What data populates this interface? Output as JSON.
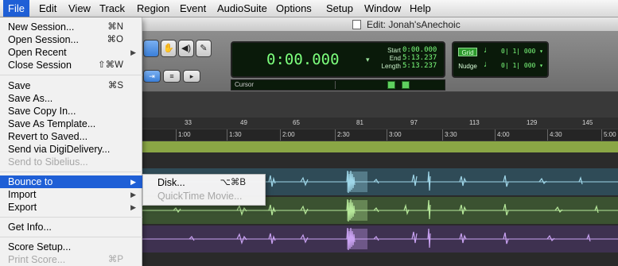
{
  "menubar": {
    "items": [
      "File",
      "Edit",
      "View",
      "Track",
      "Region",
      "Event",
      "AudioSuite",
      "Options",
      "Setup",
      "Window",
      "Help"
    ]
  },
  "window": {
    "title": "Edit: Jonah'sAnechoic"
  },
  "toolbar": {
    "main_counter": "0:00.000",
    "start_label": "Start",
    "start_value": "0:00.000",
    "end_label": "End",
    "end_value": "5:13.237",
    "length_label": "Length",
    "length_value": "5:13.237",
    "cursor_label": "Cursor",
    "grid_label": "Grid",
    "grid_value": "0| 1| 000",
    "nudge_label": "Nudge",
    "nudge_value": "0| 1| 000"
  },
  "ruler": {
    "bars": [
      "33",
      "49",
      "65",
      "81",
      "97",
      "113",
      "129",
      "145"
    ],
    "minsecs": [
      "1:00",
      "1:30",
      "2:00",
      "2:30",
      "3:00",
      "3:30",
      "4:00",
      "4:30",
      "5:00"
    ]
  },
  "file_menu": {
    "items": [
      {
        "label": "New Session...",
        "shortcut": "⌘N"
      },
      {
        "label": "Open Session...",
        "shortcut": "⌘O"
      },
      {
        "label": "Open Recent",
        "submenu": "▶"
      },
      {
        "label": "Close Session",
        "shortcut": "⇧⌘W"
      },
      {
        "label": "Save",
        "shortcut": "⌘S"
      },
      {
        "label": "Save As..."
      },
      {
        "label": "Save Copy In..."
      },
      {
        "label": "Save As Template..."
      },
      {
        "label": "Revert to Saved..."
      },
      {
        "label": "Send via DigiDelivery..."
      },
      {
        "label": "Send to Sibelius..."
      },
      {
        "label": "Bounce to",
        "submenu": "▶"
      },
      {
        "label": "Import",
        "submenu": "▶"
      },
      {
        "label": "Export",
        "submenu": "▶"
      },
      {
        "label": "Get Info..."
      },
      {
        "label": "Score Setup..."
      },
      {
        "label": "Print Score...",
        "shortcut": "⌘P"
      }
    ]
  },
  "bounce_submenu": {
    "items": [
      {
        "label": "Disk...",
        "shortcut": "⌥⌘B"
      },
      {
        "label": "QuickTime Movie..."
      }
    ]
  },
  "colors": {
    "menu_highlight": "#1f5fd6",
    "counter_green": "#7dff7d",
    "marker_ruler": "#8aa645",
    "track1": "#9fd6e8",
    "track2": "#b6e89a",
    "track3": "#c9a2f2"
  }
}
